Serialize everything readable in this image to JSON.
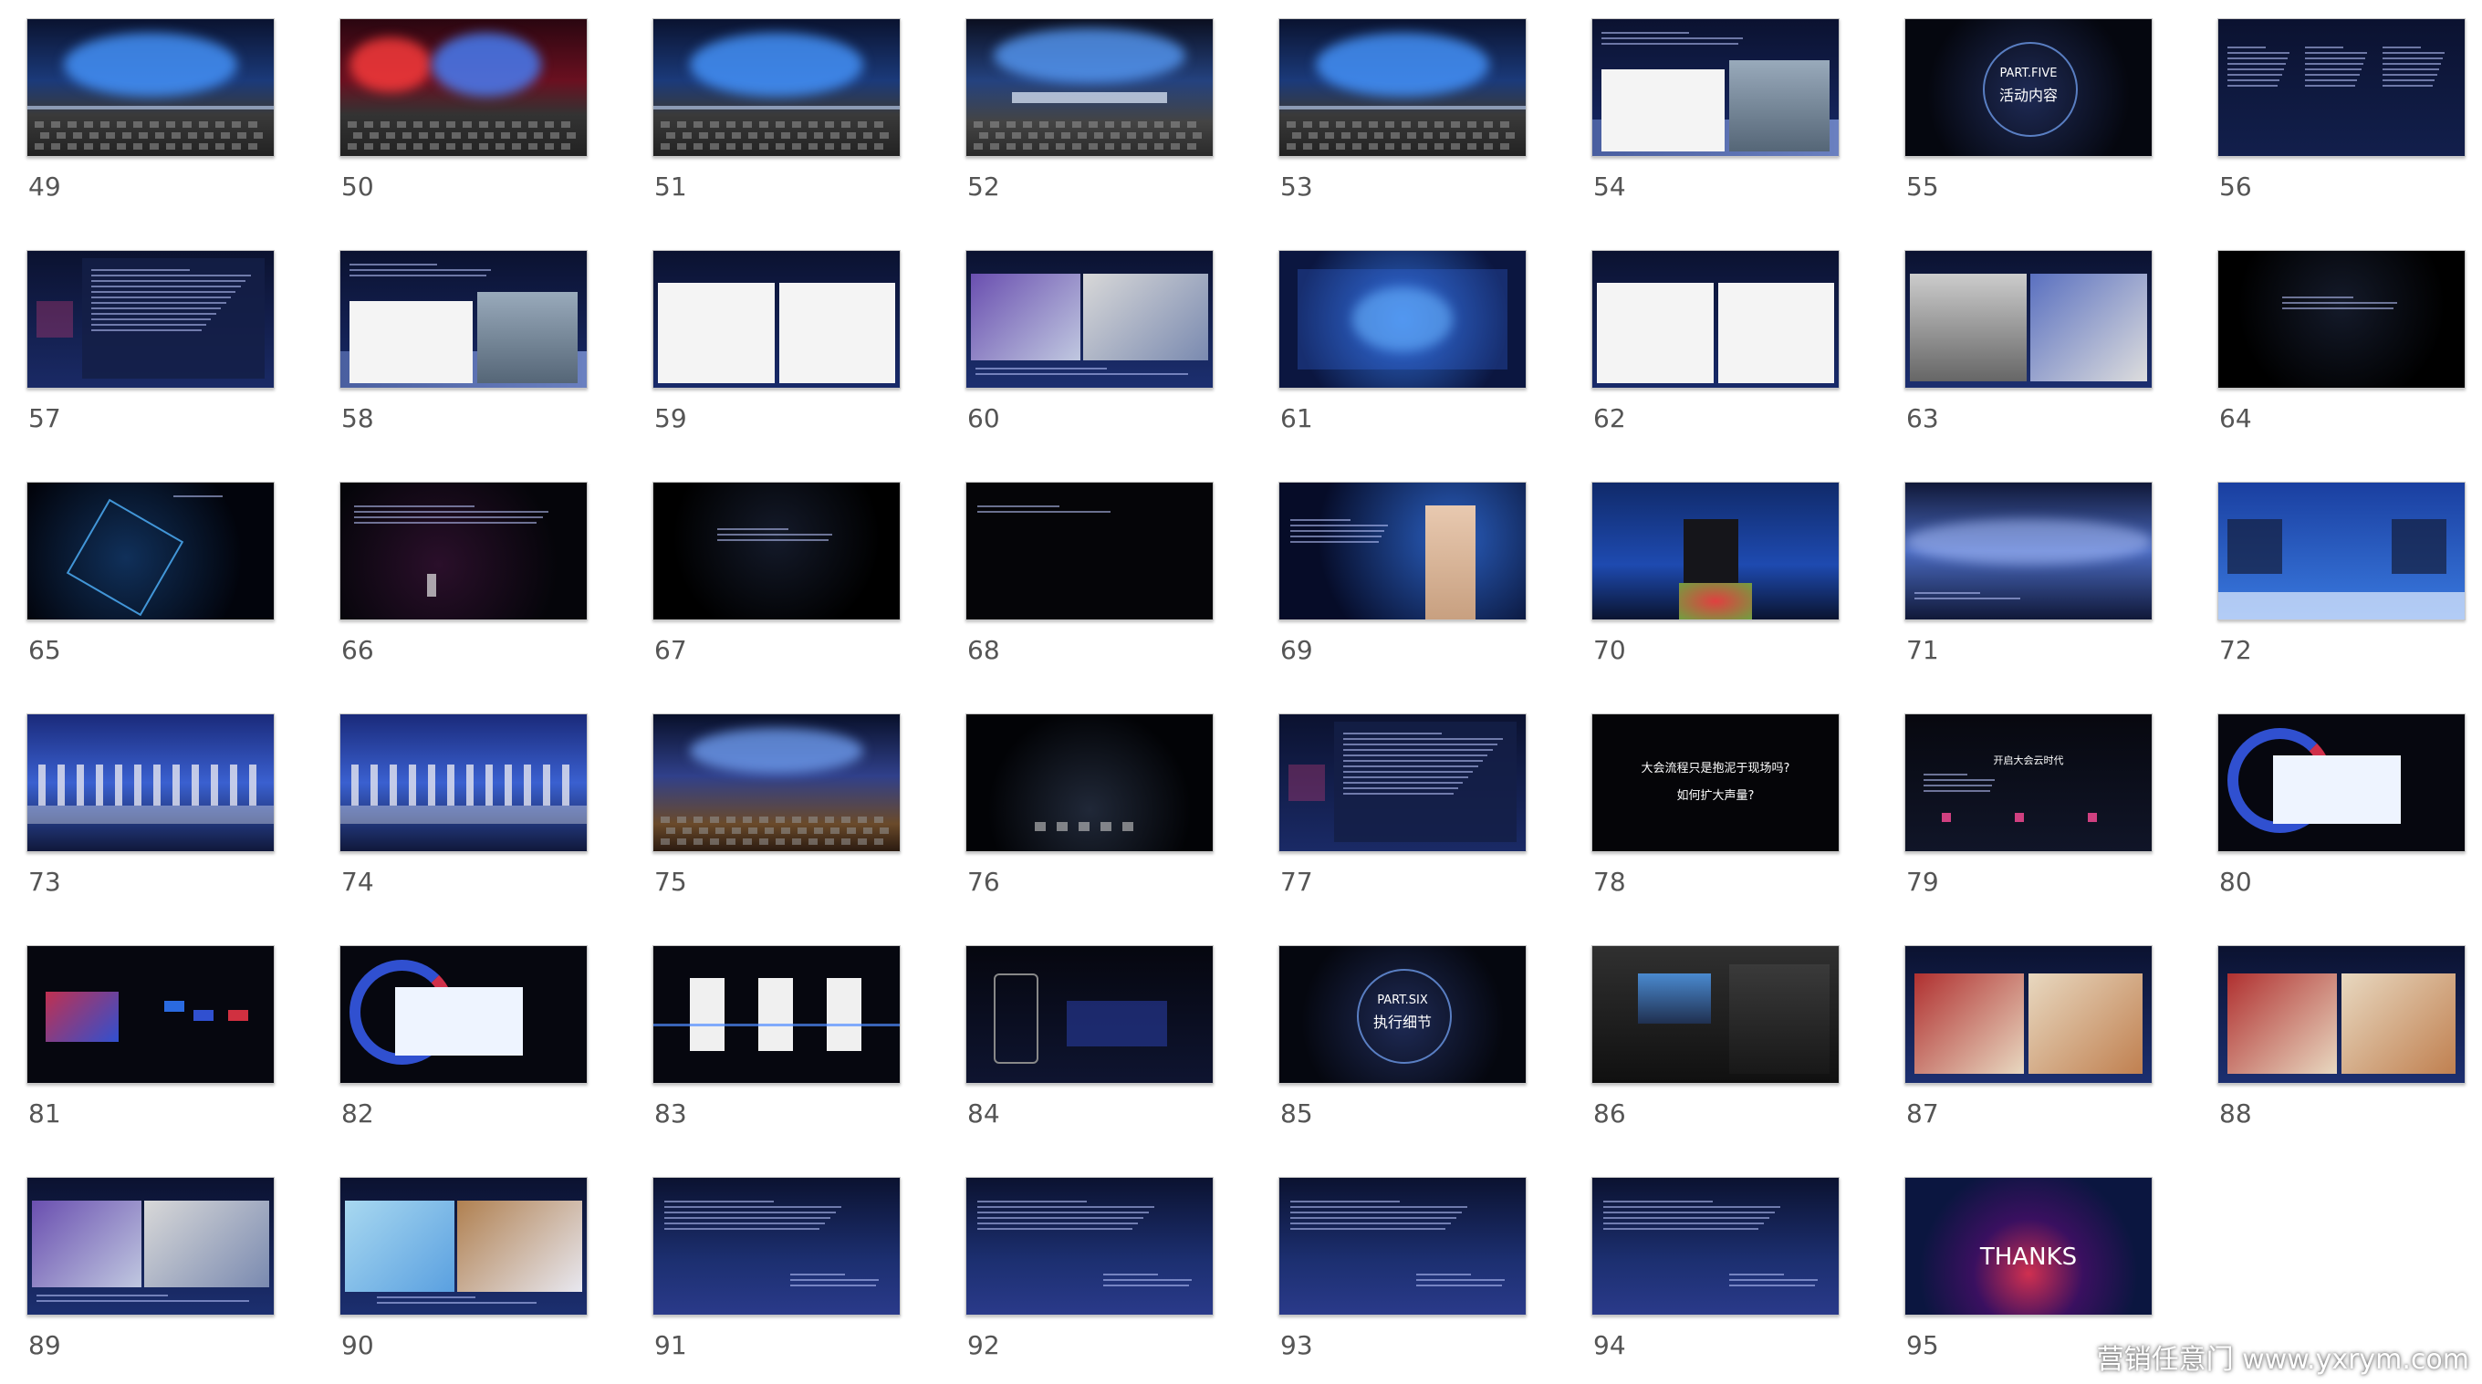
{
  "watermark": "营销任意门 www.yxrym.com",
  "slides": [
    {
      "number": "49",
      "style": "stage-blue"
    },
    {
      "number": "50",
      "style": "stage-red"
    },
    {
      "number": "51",
      "style": "stage-blue"
    },
    {
      "number": "52",
      "style": "stage-wide"
    },
    {
      "number": "53",
      "style": "stage-blue"
    },
    {
      "number": "54",
      "style": "photos-two"
    },
    {
      "number": "55",
      "style": "part-title",
      "title_en": "PART.FIVE",
      "title_cn": "活动内容"
    },
    {
      "number": "56",
      "style": "text-columns"
    },
    {
      "number": "57",
      "style": "schedule"
    },
    {
      "number": "58",
      "style": "photos-two"
    },
    {
      "number": "59",
      "style": "white-two"
    },
    {
      "number": "60",
      "style": "photos-phone"
    },
    {
      "number": "61",
      "style": "screen-blue"
    },
    {
      "number": "62",
      "style": "white-two"
    },
    {
      "number": "63",
      "style": "photos-meeting"
    },
    {
      "number": "64",
      "style": "dark-text"
    },
    {
      "number": "65",
      "style": "neon-lines"
    },
    {
      "number": "66",
      "style": "dark-figure"
    },
    {
      "number": "67",
      "style": "dark-text"
    },
    {
      "number": "68",
      "style": "dark-plain"
    },
    {
      "number": "69",
      "style": "speaker-woman"
    },
    {
      "number": "70",
      "style": "speaker-man"
    },
    {
      "number": "71",
      "style": "galaxy"
    },
    {
      "number": "72",
      "style": "panel"
    },
    {
      "number": "73",
      "style": "ceremony"
    },
    {
      "number": "74",
      "style": "ceremony"
    },
    {
      "number": "75",
      "style": "hall"
    },
    {
      "number": "76",
      "style": "dark-stage"
    },
    {
      "number": "77",
      "style": "schedule"
    },
    {
      "number": "78",
      "style": "question",
      "line1": "大会流程只是抱泥于现场吗?",
      "line2": "如何扩大声量?"
    },
    {
      "number": "79",
      "style": "dark-icons",
      "line1": "开启大会云时代"
    },
    {
      "number": "80",
      "style": "ring-screen"
    },
    {
      "number": "81",
      "style": "dark-devices"
    },
    {
      "number": "82",
      "style": "ring-screen"
    },
    {
      "number": "83",
      "style": "phones"
    },
    {
      "number": "84",
      "style": "phone-one"
    },
    {
      "number": "85",
      "style": "part-title",
      "title_en": "PART.SIX",
      "title_cn": "执行细节"
    },
    {
      "number": "86",
      "style": "camera"
    },
    {
      "number": "87",
      "style": "gift"
    },
    {
      "number": "88",
      "style": "gift"
    },
    {
      "number": "89",
      "style": "photos-phone"
    },
    {
      "number": "90",
      "style": "masks"
    },
    {
      "number": "91",
      "style": "text-doc"
    },
    {
      "number": "92",
      "style": "text-doc"
    },
    {
      "number": "93",
      "style": "text-doc"
    },
    {
      "number": "94",
      "style": "text-doc"
    },
    {
      "number": "95",
      "style": "thanks",
      "thanks": "THANKS"
    }
  ]
}
